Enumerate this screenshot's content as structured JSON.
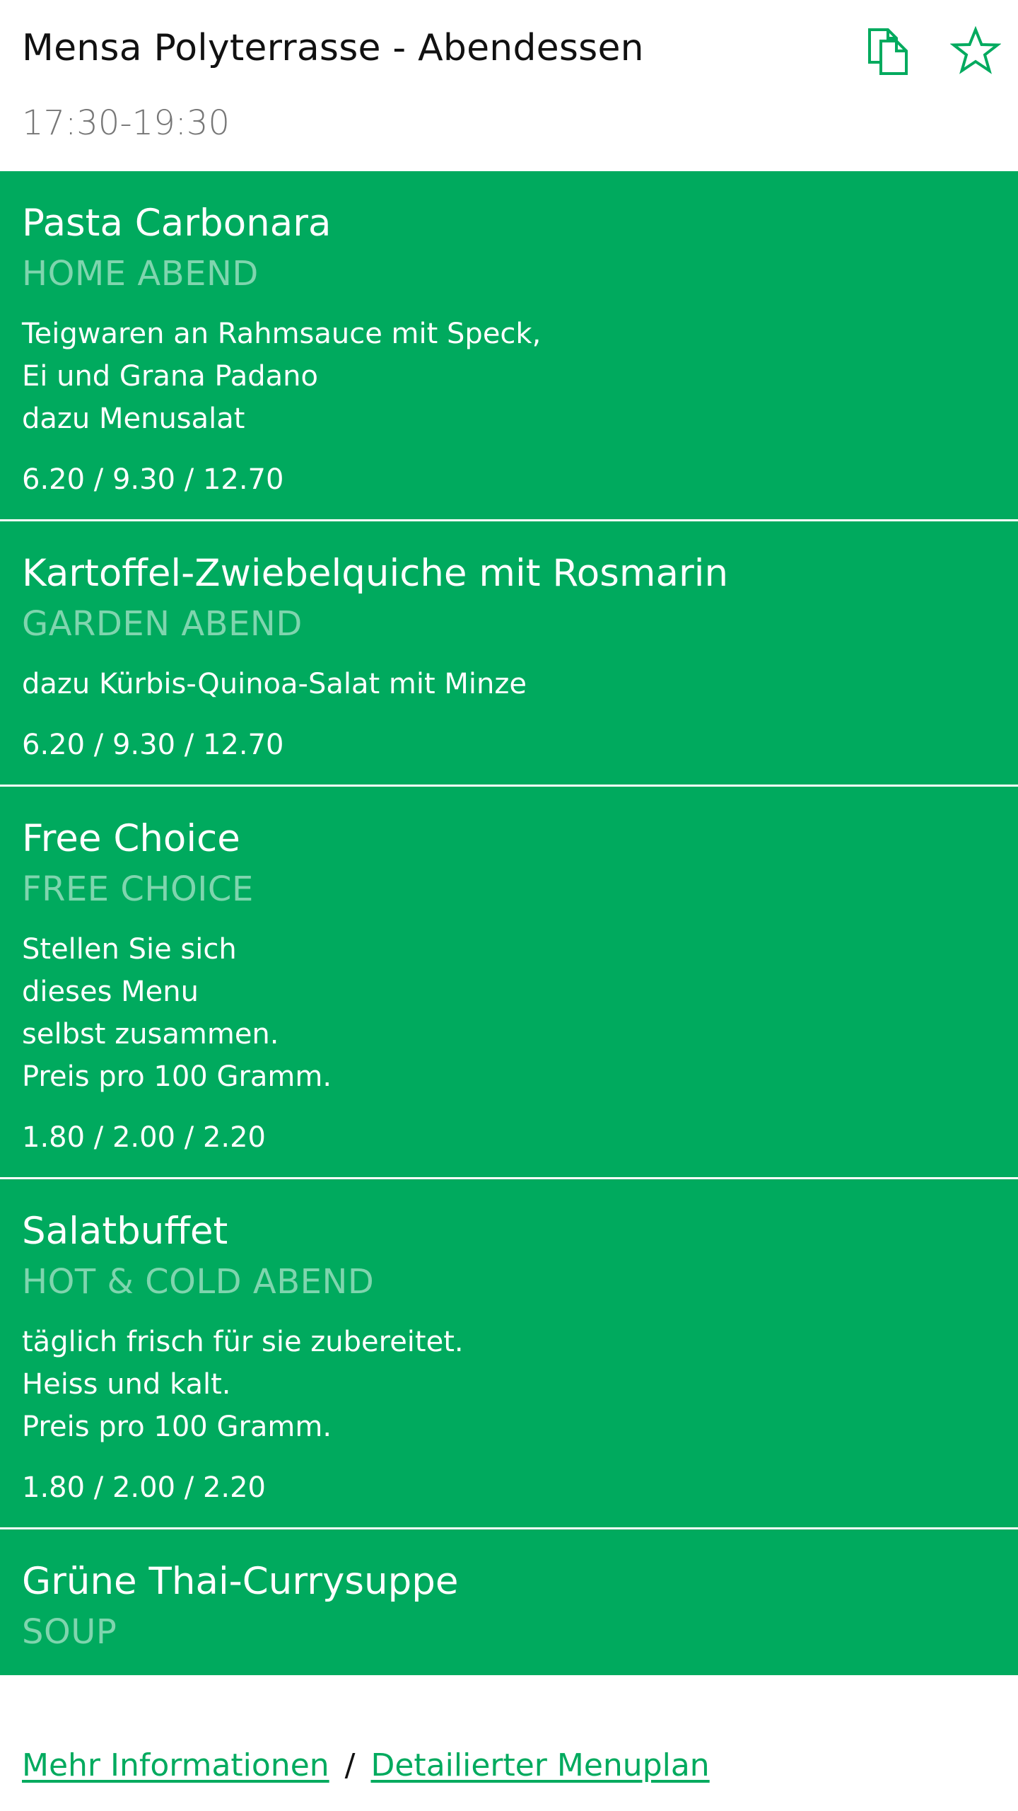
{
  "header": {
    "title": "Mensa Polyterrasse - Abendessen",
    "hours": "17:30-19:30",
    "actions": [
      {
        "name": "copy-icon",
        "icon": "copy-icon"
      },
      {
        "name": "star-icon",
        "icon": "star-icon"
      }
    ]
  },
  "colors": {
    "accent": "#00aa5e",
    "category_text": "#7fd5ae",
    "hours_text": "#777777"
  },
  "menus": [
    {
      "name": "Pasta Carbonara",
      "category": "HOME ABEND",
      "description": [
        "Teigwaren an Rahmsauce mit Speck,",
        "Ei und Grana Padano",
        "dazu Menusalat"
      ],
      "prices": "6.20 / 9.30 / 12.70"
    },
    {
      "name": "Kartoffel-Zwiebelquiche mit Rosmarin",
      "category": "GARDEN ABEND",
      "description": [
        "dazu Kürbis-Quinoa-Salat mit Minze"
      ],
      "prices": "6.20 / 9.30 / 12.70"
    },
    {
      "name": "Free Choice",
      "category": "FREE CHOICE",
      "description": [
        "Stellen Sie sich",
        "dieses Menu",
        "selbst zusammen.",
        "Preis pro 100 Gramm."
      ],
      "prices": "1.80 / 2.00 / 2.20"
    },
    {
      "name": "Salatbuffet",
      "category": "HOT & COLD ABEND",
      "description": [
        "täglich frisch für sie zubereitet.",
        "Heiss und kalt.",
        "Preis pro 100 Gramm."
      ],
      "prices": "1.80 / 2.00 / 2.20"
    },
    {
      "name": "Grüne Thai-Currysuppe",
      "category": "SOUP",
      "description": [],
      "prices": ""
    }
  ],
  "footer": {
    "more_info": "Mehr Informationen",
    "separator": "/",
    "detailed_plan": "Detailierter Menuplan"
  }
}
